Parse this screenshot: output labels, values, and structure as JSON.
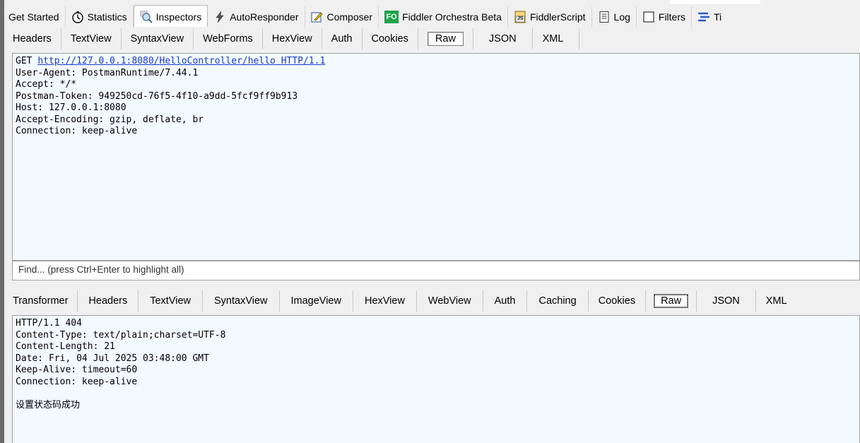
{
  "main_tabs": [
    {
      "label": "Get Started",
      "icon": "none"
    },
    {
      "label": "Statistics",
      "icon": "stopwatch-icon"
    },
    {
      "label": "Inspectors",
      "icon": "magnifier-icon"
    },
    {
      "label": "AutoResponder",
      "icon": "lightning-icon"
    },
    {
      "label": "Composer",
      "icon": "pencil-icon"
    },
    {
      "label": "Fiddler Orchestra Beta",
      "icon": "fo-icon",
      "badge": "FO"
    },
    {
      "label": "FiddlerScript",
      "icon": "script-icon",
      "badge": "JS"
    },
    {
      "label": "Log",
      "icon": "log-icon"
    },
    {
      "label": "Filters",
      "icon": "checkbox-icon"
    },
    {
      "label": "Ti",
      "icon": "timeline-icon"
    }
  ],
  "request_tabs": [
    "Headers",
    "TextView",
    "SyntaxView",
    "WebForms",
    "HexView",
    "Auth",
    "Cookies",
    "Raw",
    "JSON",
    "XML"
  ],
  "request": {
    "method": "GET",
    "url": "http://127.0.0.1:8080/HelloController/hello",
    "version": "HTTP/1.1",
    "headers": [
      "User-Agent: PostmanRuntime/7.44.1",
      "Accept: */*",
      "Postman-Token: 949250cd-76f5-4f10-a9dd-5fcf9ff9b913",
      "Host: 127.0.0.1:8080",
      "Accept-Encoding: gzip, deflate, br",
      "Connection: keep-alive"
    ]
  },
  "find_placeholder": "Find... (press Ctrl+Enter to highlight all)",
  "response_tabs": [
    "Transformer",
    "Headers",
    "TextView",
    "SyntaxView",
    "ImageView",
    "HexView",
    "WebView",
    "Auth",
    "Caching",
    "Cookies",
    "Raw",
    "JSON",
    "XML"
  ],
  "response": {
    "lines": [
      "HTTP/1.1 404",
      "Content-Type: text/plain;charset=UTF-8",
      "Content-Length: 21",
      "Date: Fri, 04 Jul 2025 03:48:00 GMT",
      "Keep-Alive: timeout=60",
      "Connection: keep-alive"
    ],
    "body": "设置状态码成功"
  },
  "colors": {
    "link": "#1a3cc8",
    "pane_bg": "#f2f9ff",
    "fo_badge": "#1aa34a"
  }
}
